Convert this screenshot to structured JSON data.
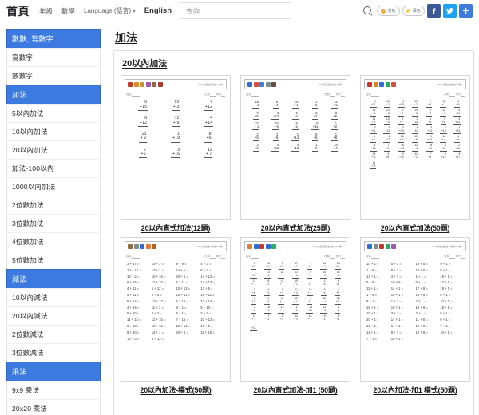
{
  "topbar": {
    "brand": "首頁",
    "nav": [
      {
        "label": "年級",
        "caret": false
      },
      {
        "label": "數學",
        "caret": false
      },
      {
        "label": "Language (語言)",
        "caret": true
      }
    ],
    "english_label": "English",
    "search": {
      "placeholder": "查詢",
      "value": ""
    },
    "search_icon": "search-icon",
    "toggles": [
      {
        "label": "淺色",
        "icon": "sun-icon"
      },
      {
        "label": "深色",
        "icon": "moon-icon"
      }
    ],
    "social": [
      {
        "name": "facebook",
        "glyph": "f",
        "color": "#3b5998"
      },
      {
        "name": "twitter",
        "glyph": "t",
        "color": "#1da1f2"
      },
      {
        "name": "share",
        "glyph": "+",
        "color": "#3f7ae0"
      }
    ]
  },
  "sidebar": {
    "groups": [
      {
        "header": "數數, 寫數字",
        "items": [
          "寫數字",
          "數數字"
        ]
      },
      {
        "header": "加法",
        "items": [
          "5以內加法",
          "10以內加法",
          "20以內加法",
          "加法-100以內",
          "1000以內加法",
          "2位數加法",
          "3位數加法",
          "4位數加法",
          "5位數加法"
        ]
      },
      {
        "header": "減法",
        "items": [
          "10以內減法",
          "20以內減法",
          "2位數減法",
          "3位數減法"
        ]
      },
      {
        "header": "乘法",
        "items": [
          "9x9 乘法",
          "20x20 乘法"
        ]
      }
    ],
    "accent_color": "#3d7ae0"
  },
  "main": {
    "page_title": "加法",
    "section_title": "20以內加法",
    "worksheets": [
      {
        "caption": "20以內直式加法(12題)",
        "format": "vertical",
        "columns": 3,
        "size": "lg",
        "header_title": "20以內直式加法(12題)",
        "icon_colors": [
          "#c0392b",
          "#e08a2e",
          "#c8902b",
          "#9b59b6",
          "#8e6b3f",
          "#b03a2e"
        ],
        "meta_left": "姓名",
        "meta_right": "日期",
        "meta_right2": "得分",
        "problems": [
          {
            "top": "5",
            "bottom": "+15"
          },
          {
            "top": "15",
            "bottom": "+ 3"
          },
          {
            "top": "7",
            "bottom": "+12"
          },
          {
            "top": "6",
            "bottom": "+12"
          },
          {
            "top": "11",
            "bottom": "+ 9"
          },
          {
            "top": "4",
            "bottom": "+14"
          },
          {
            "top": "13",
            "bottom": "+ 2"
          },
          {
            "top": "1",
            "bottom": "+19"
          },
          {
            "top": "8",
            "bottom": "+6"
          },
          {
            "top": "6",
            "bottom": "+6"
          },
          {
            "top": "3",
            "bottom": "+16"
          },
          {
            "top": "11",
            "bottom": "+ 7"
          }
        ]
      },
      {
        "caption": "20以內直式加法(25題)",
        "format": "vertical",
        "columns": 5,
        "size": "sm",
        "header_title": "20以內直式加法(25題)",
        "icon_colors": [
          "#2d6fd0",
          "#d94f3d",
          "#3b7fd4",
          "#7f8c8d",
          "#6d4c41"
        ],
        "meta_left": "姓名",
        "meta_right": "日期",
        "meta_right2": "得分",
        "problems": [
          {
            "top": "16",
            "bottom": "+ 4"
          },
          {
            "top": "6",
            "bottom": "+4"
          },
          {
            "top": "15",
            "bottom": "+ 4"
          },
          {
            "top": "1",
            "bottom": "+2"
          },
          {
            "top": "15",
            "bottom": "+ 5"
          },
          {
            "top": "7",
            "bottom": "+5"
          },
          {
            "top": "3",
            "bottom": "+13"
          },
          {
            "top": "6",
            "bottom": "+4"
          },
          {
            "top": "3",
            "bottom": "+2"
          },
          {
            "top": "3",
            "bottom": "+6"
          },
          {
            "top": "11",
            "bottom": "+ 1"
          },
          {
            "top": "10",
            "bottom": "+ 6"
          },
          {
            "top": "8",
            "bottom": "+2"
          },
          {
            "top": "8",
            "bottom": "+11"
          },
          {
            "top": "1",
            "bottom": "+2"
          },
          {
            "top": "2",
            "bottom": "+6"
          },
          {
            "top": "1",
            "bottom": "+8"
          },
          {
            "top": "1",
            "bottom": "+14"
          },
          {
            "top": "8",
            "bottom": "+8"
          },
          {
            "top": "1",
            "bottom": "+8"
          },
          {
            "top": "3",
            "bottom": "+5"
          },
          {
            "top": "9",
            "bottom": "+12"
          },
          {
            "top": "4",
            "bottom": "+13"
          },
          {
            "top": "1",
            "bottom": "+6"
          },
          {
            "top": "18",
            "bottom": "+ 4"
          }
        ]
      },
      {
        "caption": "20以內直式加法(50題)",
        "format": "vertical",
        "columns": 7,
        "size": "xs",
        "header_title": "20以內直式加法(50題)",
        "icon_colors": [
          "#c0392b",
          "#e67e22",
          "#2d6fd0",
          "#27ae60",
          "#d94f3d"
        ],
        "meta_left": "姓名",
        "meta_right": "日期",
        "meta_right2": "得分",
        "problems": [
          {
            "top": "4",
            "bottom": "+11"
          },
          {
            "top": "15",
            "bottom": "+ 3"
          },
          {
            "top": "4",
            "bottom": "+15"
          },
          {
            "top": "11",
            "bottom": "+ 2"
          },
          {
            "top": "7",
            "bottom": "+4"
          },
          {
            "top": "12",
            "bottom": "+ 7"
          },
          {
            "top": "4",
            "bottom": "+8"
          },
          {
            "top": "11",
            "bottom": "+ 4"
          },
          {
            "top": "10",
            "bottom": "+ 3"
          },
          {
            "top": "5",
            "bottom": "+3"
          },
          {
            "top": "10",
            "bottom": "+ 3"
          },
          {
            "top": "8",
            "bottom": "+3"
          },
          {
            "top": "10",
            "bottom": "+ 3"
          },
          {
            "top": "4",
            "bottom": "+11"
          },
          {
            "top": "11",
            "bottom": "+ 2"
          },
          {
            "top": "10",
            "bottom": "+ 5"
          },
          {
            "top": "8",
            "bottom": "+7"
          },
          {
            "top": "3",
            "bottom": "+16"
          },
          {
            "top": "3",
            "bottom": "+6"
          },
          {
            "top": "7",
            "bottom": "+6"
          },
          {
            "top": "4",
            "bottom": "+13"
          },
          {
            "top": "3",
            "bottom": "+11"
          },
          {
            "top": "3",
            "bottom": "+13"
          },
          {
            "top": "3",
            "bottom": "+13"
          },
          {
            "top": "4",
            "bottom": "+10"
          },
          {
            "top": "3",
            "bottom": "+13"
          },
          {
            "top": "3",
            "bottom": "+10"
          },
          {
            "top": "4",
            "bottom": "+13"
          },
          {
            "top": "8",
            "bottom": "+7"
          },
          {
            "top": "1",
            "bottom": "+17"
          },
          {
            "top": "16",
            "bottom": "+ 4"
          },
          {
            "top": "12",
            "bottom": "+ 8"
          },
          {
            "top": "1",
            "bottom": "+12"
          },
          {
            "top": "16",
            "bottom": "+ 4"
          },
          {
            "top": "4",
            "bottom": "+6"
          },
          {
            "top": "11",
            "bottom": "+10"
          },
          {
            "top": "7",
            "bottom": "+3"
          },
          {
            "top": "6",
            "bottom": "+14"
          },
          {
            "top": "12",
            "bottom": "+ 4"
          },
          {
            "top": "8",
            "bottom": "+10"
          },
          {
            "top": "8",
            "bottom": "+12"
          },
          {
            "top": "2",
            "bottom": "+16"
          },
          {
            "top": "11",
            "bottom": "+ 3"
          },
          {
            "top": "3",
            "bottom": "+8"
          },
          {
            "top": "2",
            "bottom": "+10"
          },
          {
            "top": "11",
            "bottom": "+ 2"
          },
          {
            "top": "7",
            "bottom": "+8"
          },
          {
            "top": "8",
            "bottom": "+12"
          },
          {
            "top": "3",
            "bottom": "+17"
          },
          {
            "top": "11",
            "bottom": "+ 3"
          }
        ]
      },
      {
        "caption": "20以內加法-橫式(50題)",
        "format": "horizontal",
        "columns": 4,
        "size": "sm",
        "header_title": "20以內加法-橫式(50題)",
        "icon_colors": [
          "#8e6b3f",
          "#7f8c8d",
          "#2d6fd0",
          "#e07b39",
          "#b5651d"
        ],
        "meta_left": "姓名",
        "meta_right": "日期",
        "meta_right2": "得分",
        "problems": [
          "3 + 17 =",
          "10 + 3 =",
          "9 + 9 =",
          "4 + 3 =",
          "10 + 10 =",
          "17 + 1 =",
          "14 + 1 =",
          "8 + 2 =",
          "14 + 2 =",
          "10 + 10 =",
          "20 + 5 =",
          "17 + 12 =",
          "6 + 15 =",
          "12 + 15 =",
          "5 + 11 =",
          "17 + 13 =",
          "4 + 11 =",
          "5 + 12 =",
          "10 + 13 =",
          "13 + 5 =",
          "4 + 11 =",
          "6 + 5 =",
          "20 + 11 =",
          "18 + 11 =",
          "5 + 14 =",
          "13 + 17 =",
          "5 + 12 =",
          "10 + 14 =",
          "4 + 14 =",
          "11 + 1 =",
          "9 + 1 =",
          "5 + 10 =",
          "5 + 10 =",
          "2 + 2 =",
          "6 + 1 =",
          "3 + 2 =",
          "11 + 14 =",
          "12 + 15 =",
          "7 + 15 =",
          "10 + 12 =",
          "2 + 13 =",
          "13 + 15 =",
          "10 + 14 =",
          "10 + 5 =",
          "9 + 10 =",
          "14 + 4 =",
          "20 + 6 =",
          "11 + 10 =",
          "10 + 3 =",
          "6 + 13 ="
        ]
      },
      {
        "caption": "20以內直式加法-加1 (50題)",
        "format": "vertical",
        "columns": 7,
        "size": "xs",
        "header_title": "20以內直式加法-加1 (50題)",
        "icon_colors": [
          "#e07b39",
          "#2d6fd0",
          "#c0392b",
          "#2d6fd0",
          "#27ae60"
        ],
        "meta_left": "姓名",
        "meta_right": "日期",
        "meta_right2": "得分",
        "problems": [
          {
            "top": "5",
            "bottom": "+1"
          },
          {
            "top": "18",
            "bottom": "+ 1"
          },
          {
            "top": "6",
            "bottom": "+1"
          },
          {
            "top": "17",
            "bottom": "+ 1"
          },
          {
            "top": "4",
            "bottom": "+1"
          },
          {
            "top": "14",
            "bottom": "+ 1"
          },
          {
            "top": "14",
            "bottom": "+ 1"
          },
          {
            "top": "1",
            "bottom": "+11"
          },
          {
            "top": "14",
            "bottom": "+ 1"
          },
          {
            "top": "18",
            "bottom": "+ 1"
          },
          {
            "top": "11",
            "bottom": "+ 1"
          },
          {
            "top": "9",
            "bottom": "+1"
          },
          {
            "top": "14",
            "bottom": "+ 1"
          },
          {
            "top": "14",
            "bottom": "+ 1"
          },
          {
            "top": "11",
            "bottom": "+ 1"
          },
          {
            "top": "8",
            "bottom": "+1"
          },
          {
            "top": "14",
            "bottom": "+ 1"
          },
          {
            "top": "10",
            "bottom": "+ 1"
          },
          {
            "top": "7",
            "bottom": "+1"
          },
          {
            "top": "1",
            "bottom": "+4"
          },
          {
            "top": "8",
            "bottom": "+1"
          },
          {
            "top": "1",
            "bottom": "+8"
          },
          {
            "top": "4",
            "bottom": "+1"
          },
          {
            "top": "8",
            "bottom": "+1"
          },
          {
            "top": "11",
            "bottom": "+ 1"
          },
          {
            "top": "13",
            "bottom": "+ 1"
          },
          {
            "top": "9",
            "bottom": "+1"
          },
          {
            "top": "1",
            "bottom": "+7"
          },
          {
            "top": "1",
            "bottom": "+1"
          },
          {
            "top": "1",
            "bottom": "+3"
          },
          {
            "top": "13",
            "bottom": "+ 1"
          },
          {
            "top": "12",
            "bottom": "+ 1"
          },
          {
            "top": "7",
            "bottom": "+1"
          },
          {
            "top": "16",
            "bottom": "+ 1"
          },
          {
            "top": "12",
            "bottom": "+ 1"
          },
          {
            "top": "2",
            "bottom": "+1"
          },
          {
            "top": "16",
            "bottom": "+ 1"
          },
          {
            "top": "13",
            "bottom": "+ 1"
          },
          {
            "top": "4",
            "bottom": "+1"
          },
          {
            "top": "14",
            "bottom": "+12"
          },
          {
            "top": "11",
            "bottom": "+ 1"
          },
          {
            "top": "4",
            "bottom": "+1"
          },
          {
            "top": "11",
            "bottom": "+ 1"
          },
          {
            "top": "7",
            "bottom": "+1"
          },
          {
            "top": "8",
            "bottom": "+1"
          },
          {
            "top": "11",
            "bottom": "+ 1"
          },
          {
            "top": "14",
            "bottom": "+ 1"
          },
          {
            "top": "9",
            "bottom": "+1"
          },
          {
            "top": "8",
            "bottom": "+1"
          },
          {
            "top": "1",
            "bottom": "+11"
          }
        ]
      },
      {
        "caption": "20以內加法-加1 橫式(50題)",
        "format": "horizontal",
        "columns": 4,
        "size": "sm",
        "header_title": "20以內加法-加1 橫式(50題)",
        "icon_colors": [
          "#2d6fd0",
          "#7f8c8d",
          "#c0392b",
          "#27ae60",
          "#9b59b6"
        ],
        "meta_left": "姓名",
        "meta_right": "日期",
        "meta_right2": "得分",
        "problems": [
          "10 + 1 =",
          "5 + 1 =",
          "19 + 8 =",
          "9 + 1 =",
          "1 + 8 =",
          "8 + 1 =",
          "19 + 8 =",
          "5 + 1 =",
          "13 + 1 =",
          "4 + 1 =",
          "1 + 1 =",
          "18 + 1 =",
          "5 + 8 =",
          "10 + 8 =",
          "5 + 1 =",
          "17 + 1 =",
          "11 + 1 =",
          "14 + 1 =",
          "17 + 8 =",
          "19 + 1 =",
          "1 + 8 =",
          "10 + 1 =",
          "19 + 8 =",
          "5 + 1 =",
          "9 + 1 =",
          "1 + 1 =",
          "2 + 1 =",
          "10 + 1 =",
          "18 + 1 =",
          "10 + 1 =",
          "19 + 8 =",
          "18 + 1 =",
          "10 + 1 =",
          "3 + 1 =",
          "2 + 1 =",
          "6 + 1 =",
          "20 + 1 =",
          "14 + 1 =",
          "11 + 8 =",
          "9 + 1 =",
          "10 + 1 =",
          "14 + 1 =",
          "19 + 8 =",
          "7 + 1 =",
          "11 + 1 =",
          "8 + 1 =",
          "10 + 8 =",
          "10 + 1 =",
          "7 + 1 =",
          "10 + 1 ="
        ]
      }
    ]
  }
}
